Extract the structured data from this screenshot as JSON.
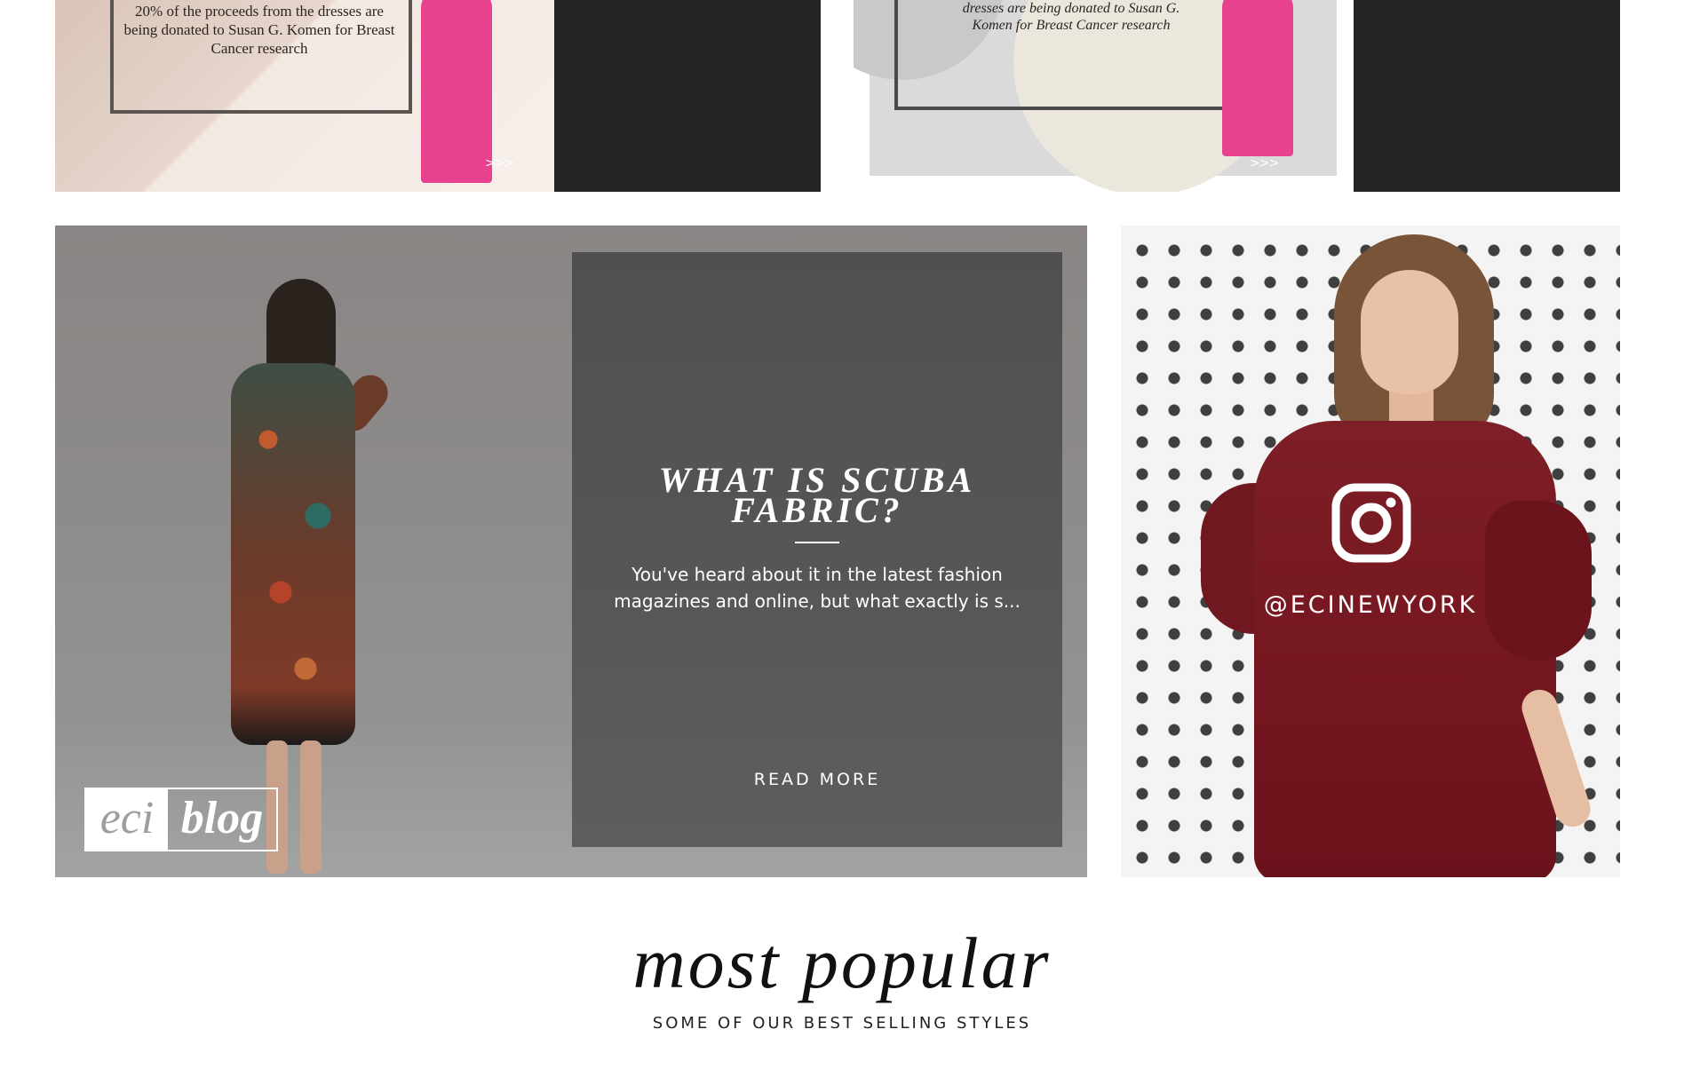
{
  "promos": {
    "left": {
      "text": "20% of the proceeds from the dresses are being donated to Susan G. Komen for Breast Cancer research",
      "arrows": ">>>"
    },
    "right": {
      "text": "dresses are being donated to Susan G. Komen for Breast Cancer research",
      "arrows": ">>>"
    }
  },
  "blog": {
    "logo_eci": "eci",
    "logo_blog": "blog",
    "title": "WHAT IS SCUBA FABRIC?",
    "excerpt": "You've heard about it in the latest fashion magazines and online, but what exactly is s...",
    "read_more": "READ MORE"
  },
  "instagram": {
    "icon": "instagram-icon",
    "handle": "@ECINEWYORK"
  },
  "popular": {
    "title": "most popular",
    "subtitle": "SOME OF OUR BEST SELLING STYLES"
  },
  "colors": {
    "dark_panel": "#232323",
    "pink_dress": "#e8418e",
    "burgundy_dress": "#74161f"
  }
}
